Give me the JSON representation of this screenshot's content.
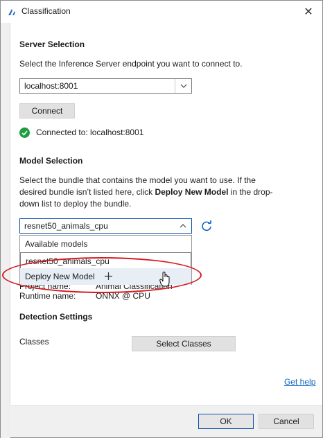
{
  "window": {
    "title": "Classification",
    "close_glyph": "✕"
  },
  "server": {
    "section_title": "Server Selection",
    "instruction": "Select the Inference Server endpoint you want to connect to.",
    "endpoint_value": "localhost:8001",
    "connect_label": "Connect",
    "status_text": "Connected to: localhost:8001"
  },
  "model": {
    "section_title": "Model Selection",
    "instruction_line1": "Select the bundle that contains the model you want to use. If the",
    "instruction_line2_pre": "desired bundle isn’t listed here, click ",
    "instruction_line2_bold": "Deploy New Model",
    "instruction_line2_post": " in the drop-",
    "instruction_line3": "down list to deploy the bundle.",
    "selected_value": "resnet50_animals_cpu",
    "dropdown_items": {
      "header": "Available models",
      "option": "resnet50_animals_cpu",
      "deploy": "Deploy New Model"
    },
    "obscured_label": "Project name:",
    "obscured_value": "Animal Classification",
    "runtime_label": "Runtime name:",
    "runtime_value": "ONNX @ CPU"
  },
  "detection": {
    "section_title": "Detection Settings",
    "classes_label": "Classes",
    "select_classes_label": "Select Classes"
  },
  "help_link": "Get help",
  "footer": {
    "ok_label": "OK",
    "cancel_label": "Cancel"
  },
  "colors": {
    "accent": "#0a4fa8",
    "success": "#1e9e3e",
    "highlight": "#d71920"
  },
  "icons": [
    "app-icon",
    "close-icon",
    "chevron-down-icon",
    "chevron-up-icon",
    "check-circle-icon",
    "refresh-icon",
    "plus-icon",
    "hand-cursor-icon"
  ]
}
